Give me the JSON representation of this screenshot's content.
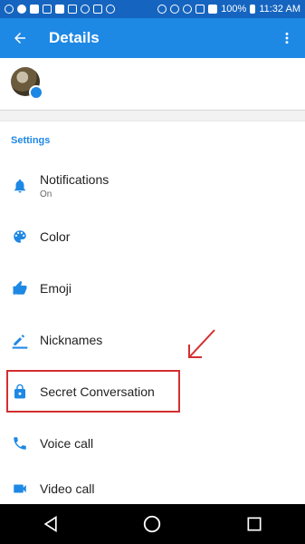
{
  "status_bar": {
    "battery": "100%",
    "time": "11:32 AM"
  },
  "app_bar": {
    "title": "Details"
  },
  "settings": {
    "section_title": "Settings",
    "items": [
      {
        "label": "Notifications",
        "sub": "On",
        "icon": "bell-icon"
      },
      {
        "label": "Color",
        "sub": "",
        "icon": "palette-icon"
      },
      {
        "label": "Emoji",
        "sub": "",
        "icon": "thumbs-up-icon"
      },
      {
        "label": "Nicknames",
        "sub": "",
        "icon": "pencil-icon"
      },
      {
        "label": "Secret Conversation",
        "sub": "",
        "icon": "lock-icon"
      },
      {
        "label": "Voice call",
        "sub": "",
        "icon": "phone-icon"
      },
      {
        "label": "Video call",
        "sub": "",
        "icon": "video-camera-icon"
      }
    ]
  },
  "colors": {
    "accent": "#1e88e5",
    "status_bar": "#1565c0",
    "annotation": "#d32f2f"
  }
}
